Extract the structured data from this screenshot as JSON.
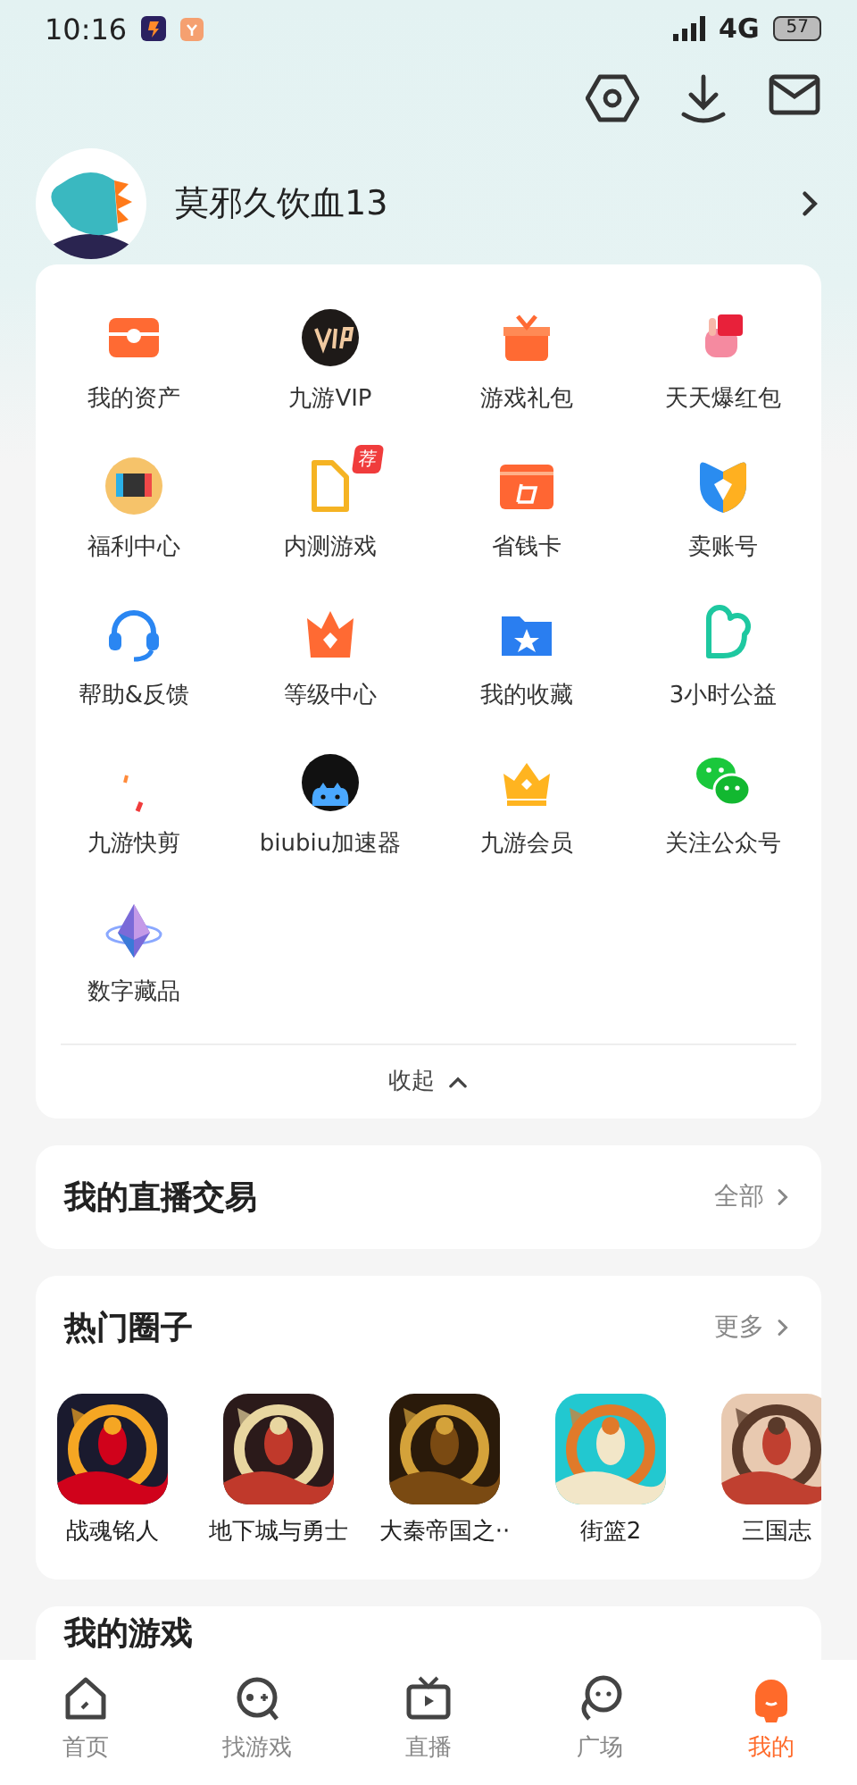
{
  "status_bar": {
    "time": "10:16",
    "network": "4G",
    "battery": "57"
  },
  "profile": {
    "name": "莫邪久饮血13"
  },
  "menu": {
    "items": [
      {
        "label": "我的资产"
      },
      {
        "label": "九游VIP"
      },
      {
        "label": "游戏礼包"
      },
      {
        "label": "天天爆红包"
      },
      {
        "label": "福利中心"
      },
      {
        "label": "内测游戏",
        "badge": "荐"
      },
      {
        "label": "省钱卡"
      },
      {
        "label": "卖账号"
      },
      {
        "label": "帮助&反馈"
      },
      {
        "label": "等级中心"
      },
      {
        "label": "我的收藏"
      },
      {
        "label": "3小时公益"
      },
      {
        "label": "九游快剪"
      },
      {
        "label": "biubiu加速器"
      },
      {
        "label": "九游会员"
      },
      {
        "label": "关注公众号"
      },
      {
        "label": "数字藏品"
      }
    ],
    "collapse": "收起"
  },
  "live_trade": {
    "title": "我的直播交易",
    "more": "全部"
  },
  "hot_circles": {
    "title": "热门圈子",
    "more": "更多",
    "games": [
      {
        "name": "战魂铭人"
      },
      {
        "name": "地下城与勇士"
      },
      {
        "name": "大秦帝国之··"
      },
      {
        "name": "街篮2"
      },
      {
        "name": "三国志"
      }
    ]
  },
  "my_games": {
    "title": "我的游戏"
  },
  "tabs": [
    {
      "label": "首页",
      "selected": false
    },
    {
      "label": "找游戏",
      "selected": false
    },
    {
      "label": "直播",
      "selected": false
    },
    {
      "label": "广场",
      "selected": false
    },
    {
      "label": "我的",
      "selected": true
    }
  ]
}
